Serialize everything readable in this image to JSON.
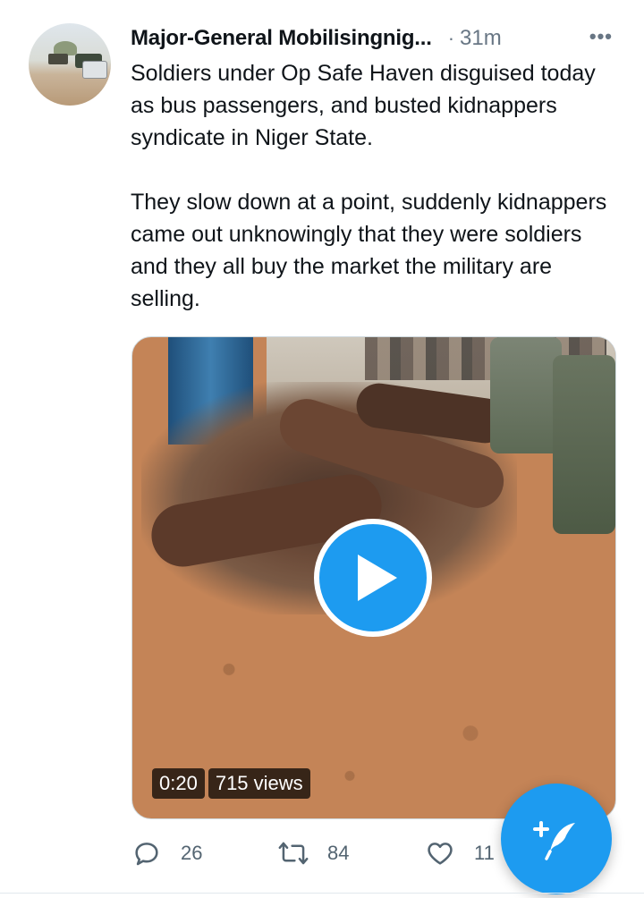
{
  "tweet": {
    "author_name": "Major-General Mobilisingnig...",
    "separator": "·",
    "time": "31m",
    "more_label": "•••",
    "text": "Soldiers under Op Safe Haven disguised today as bus passengers, and busted kidnappers syndicate in Niger State.\n\nThey slow down at a point, suddenly kidnappers came out unknowingly that they were soldiers and they all buy the market the military are selling."
  },
  "media": {
    "type": "video",
    "duration": "0:20",
    "views": "715 views",
    "play_icon": "play-icon"
  },
  "actions": {
    "reply_count": "26",
    "retweet_count": "84",
    "like_count": "11"
  },
  "fab": {
    "icon": "compose-tweet-icon"
  },
  "colors": {
    "accent": "#1d9bf0",
    "text_primary": "#0f1419",
    "text_secondary": "#687684"
  }
}
